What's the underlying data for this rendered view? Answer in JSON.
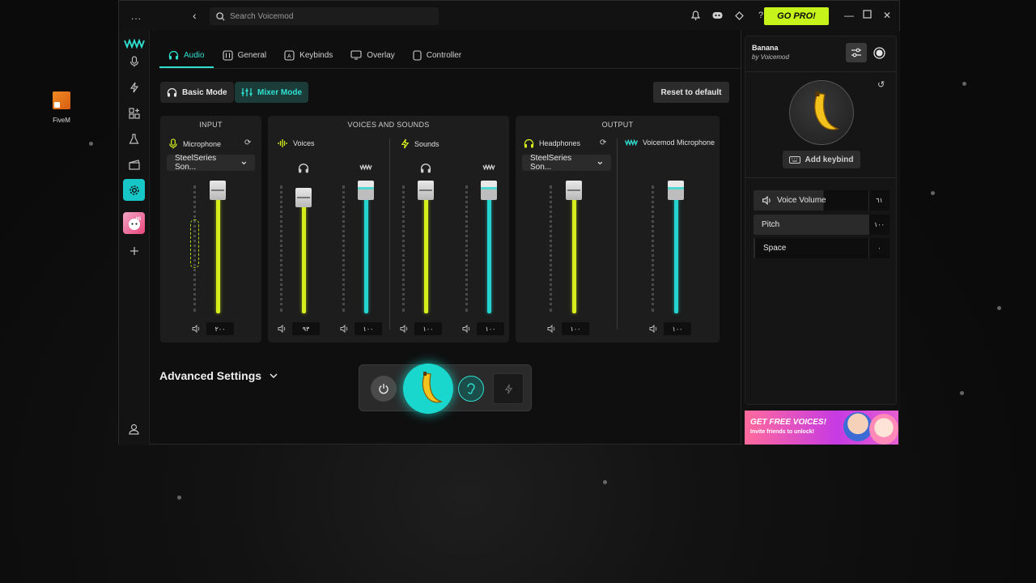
{
  "desktop": {
    "icon_label": "FiveM"
  },
  "titlebar": {
    "menu_dots": "...",
    "search_placeholder": "Search Voicemod",
    "go_pro_label": "GO PRO!"
  },
  "tabs": [
    {
      "label": "Audio"
    },
    {
      "label": "General"
    },
    {
      "label": "Keybinds"
    },
    {
      "label": "Overlay"
    },
    {
      "label": "Controller"
    }
  ],
  "modes": {
    "basic_label": "Basic Mode",
    "mixer_label": "Mixer Mode",
    "reset_label": "Reset to default"
  },
  "mixer": {
    "input": {
      "title": "INPUT",
      "channel_label": "Microphone",
      "device": "SteelSeries Son...",
      "value": "٢٠٠",
      "level": 1.0
    },
    "voices_sounds": {
      "title": "VOICES AND SOUNDS",
      "voices": {
        "label": "Voices",
        "monitor_value": "٩٣",
        "output_value": "١٠٠",
        "monitor_level": 0.93,
        "output_level": 1.0
      },
      "sounds": {
        "label": "Sounds",
        "monitor_value": "١٠٠",
        "output_value": "١٠٠",
        "monitor_level": 1.0,
        "output_level": 1.0
      }
    },
    "output": {
      "title": "OUTPUT",
      "headphones": {
        "label": "Headphones",
        "device": "SteelSeries Son...",
        "value": "١٠٠",
        "level": 1.0
      },
      "voicemod_mic": {
        "label": "Voicemod Microphone",
        "value": "١٠٠",
        "level": 1.0
      }
    }
  },
  "advanced_settings_label": "Advanced Settings",
  "voice_panel": {
    "name": "Banana",
    "by": "by Voicemod",
    "add_keybind_label": "Add keybind",
    "params": [
      {
        "label": "Voice Volume",
        "value": "٦١",
        "fill": 0.61
      },
      {
        "label": "Pitch",
        "value": "١٠٠",
        "fill": 1.0
      },
      {
        "label": "Space",
        "value": "٠",
        "fill": 0.0
      }
    ]
  },
  "promo": {
    "title": "GET FREE VOICES!",
    "subtitle": "Invite friends to unlock!"
  },
  "colors": {
    "accent_cyan": "#2fe0d0",
    "accent_yellow": "#d6ef1c",
    "go_pro": "#c6f41a"
  }
}
